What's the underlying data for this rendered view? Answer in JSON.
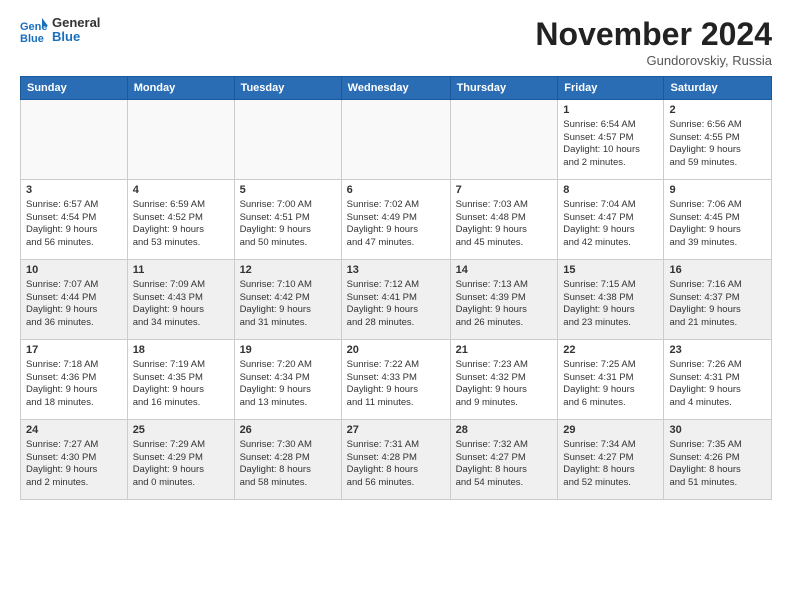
{
  "logo": {
    "general": "General",
    "blue": "Blue"
  },
  "header": {
    "month": "November 2024",
    "location": "Gundorovskiy, Russia"
  },
  "weekdays": [
    "Sunday",
    "Monday",
    "Tuesday",
    "Wednesday",
    "Thursday",
    "Friday",
    "Saturday"
  ],
  "weeks": [
    [
      {
        "day": "",
        "info": "",
        "empty": true
      },
      {
        "day": "",
        "info": "",
        "empty": true
      },
      {
        "day": "",
        "info": "",
        "empty": true
      },
      {
        "day": "",
        "info": "",
        "empty": true
      },
      {
        "day": "",
        "info": "",
        "empty": true
      },
      {
        "day": "1",
        "info": "Sunrise: 6:54 AM\nSunset: 4:57 PM\nDaylight: 10 hours\nand 2 minutes."
      },
      {
        "day": "2",
        "info": "Sunrise: 6:56 AM\nSunset: 4:55 PM\nDaylight: 9 hours\nand 59 minutes."
      }
    ],
    [
      {
        "day": "3",
        "info": "Sunrise: 6:57 AM\nSunset: 4:54 PM\nDaylight: 9 hours\nand 56 minutes."
      },
      {
        "day": "4",
        "info": "Sunrise: 6:59 AM\nSunset: 4:52 PM\nDaylight: 9 hours\nand 53 minutes."
      },
      {
        "day": "5",
        "info": "Sunrise: 7:00 AM\nSunset: 4:51 PM\nDaylight: 9 hours\nand 50 minutes."
      },
      {
        "day": "6",
        "info": "Sunrise: 7:02 AM\nSunset: 4:49 PM\nDaylight: 9 hours\nand 47 minutes."
      },
      {
        "day": "7",
        "info": "Sunrise: 7:03 AM\nSunset: 4:48 PM\nDaylight: 9 hours\nand 45 minutes."
      },
      {
        "day": "8",
        "info": "Sunrise: 7:04 AM\nSunset: 4:47 PM\nDaylight: 9 hours\nand 42 minutes."
      },
      {
        "day": "9",
        "info": "Sunrise: 7:06 AM\nSunset: 4:45 PM\nDaylight: 9 hours\nand 39 minutes."
      }
    ],
    [
      {
        "day": "10",
        "info": "Sunrise: 7:07 AM\nSunset: 4:44 PM\nDaylight: 9 hours\nand 36 minutes.",
        "shaded": true
      },
      {
        "day": "11",
        "info": "Sunrise: 7:09 AM\nSunset: 4:43 PM\nDaylight: 9 hours\nand 34 minutes.",
        "shaded": true
      },
      {
        "day": "12",
        "info": "Sunrise: 7:10 AM\nSunset: 4:42 PM\nDaylight: 9 hours\nand 31 minutes.",
        "shaded": true
      },
      {
        "day": "13",
        "info": "Sunrise: 7:12 AM\nSunset: 4:41 PM\nDaylight: 9 hours\nand 28 minutes.",
        "shaded": true
      },
      {
        "day": "14",
        "info": "Sunrise: 7:13 AM\nSunset: 4:39 PM\nDaylight: 9 hours\nand 26 minutes.",
        "shaded": true
      },
      {
        "day": "15",
        "info": "Sunrise: 7:15 AM\nSunset: 4:38 PM\nDaylight: 9 hours\nand 23 minutes.",
        "shaded": true
      },
      {
        "day": "16",
        "info": "Sunrise: 7:16 AM\nSunset: 4:37 PM\nDaylight: 9 hours\nand 21 minutes.",
        "shaded": true
      }
    ],
    [
      {
        "day": "17",
        "info": "Sunrise: 7:18 AM\nSunset: 4:36 PM\nDaylight: 9 hours\nand 18 minutes."
      },
      {
        "day": "18",
        "info": "Sunrise: 7:19 AM\nSunset: 4:35 PM\nDaylight: 9 hours\nand 16 minutes."
      },
      {
        "day": "19",
        "info": "Sunrise: 7:20 AM\nSunset: 4:34 PM\nDaylight: 9 hours\nand 13 minutes."
      },
      {
        "day": "20",
        "info": "Sunrise: 7:22 AM\nSunset: 4:33 PM\nDaylight: 9 hours\nand 11 minutes."
      },
      {
        "day": "21",
        "info": "Sunrise: 7:23 AM\nSunset: 4:32 PM\nDaylight: 9 hours\nand 9 minutes."
      },
      {
        "day": "22",
        "info": "Sunrise: 7:25 AM\nSunset: 4:31 PM\nDaylight: 9 hours\nand 6 minutes."
      },
      {
        "day": "23",
        "info": "Sunrise: 7:26 AM\nSunset: 4:31 PM\nDaylight: 9 hours\nand 4 minutes."
      }
    ],
    [
      {
        "day": "24",
        "info": "Sunrise: 7:27 AM\nSunset: 4:30 PM\nDaylight: 9 hours\nand 2 minutes.",
        "shaded": true
      },
      {
        "day": "25",
        "info": "Sunrise: 7:29 AM\nSunset: 4:29 PM\nDaylight: 9 hours\nand 0 minutes.",
        "shaded": true
      },
      {
        "day": "26",
        "info": "Sunrise: 7:30 AM\nSunset: 4:28 PM\nDaylight: 8 hours\nand 58 minutes.",
        "shaded": true
      },
      {
        "day": "27",
        "info": "Sunrise: 7:31 AM\nSunset: 4:28 PM\nDaylight: 8 hours\nand 56 minutes.",
        "shaded": true
      },
      {
        "day": "28",
        "info": "Sunrise: 7:32 AM\nSunset: 4:27 PM\nDaylight: 8 hours\nand 54 minutes.",
        "shaded": true
      },
      {
        "day": "29",
        "info": "Sunrise: 7:34 AM\nSunset: 4:27 PM\nDaylight: 8 hours\nand 52 minutes.",
        "shaded": true
      },
      {
        "day": "30",
        "info": "Sunrise: 7:35 AM\nSunset: 4:26 PM\nDaylight: 8 hours\nand 51 minutes.",
        "shaded": true
      }
    ]
  ]
}
